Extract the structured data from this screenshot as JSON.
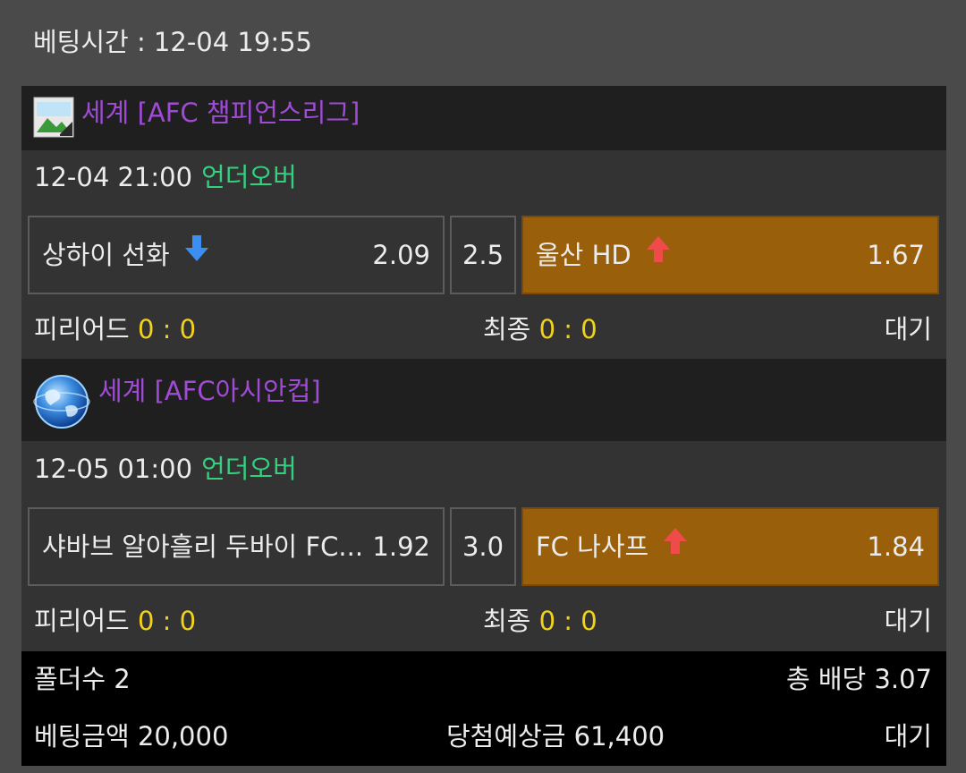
{
  "bet_time": "베팅시간 : 12-04 19:55",
  "matches": [
    {
      "league": "세계 [AFC 챔피언스리그]",
      "league_icon": "broken-image-icon",
      "time": "12-04 21:00",
      "type": "언더오버",
      "home": {
        "name": "상하이 선화",
        "odds": "2.09",
        "arrow": "down"
      },
      "line": "2.5",
      "away": {
        "name": "울산 HD",
        "odds": "1.67",
        "arrow": "up",
        "selected": true
      },
      "period_label": "피리어드",
      "period_score": "0 : 0",
      "final_label": "최종",
      "final_score": "0 : 0",
      "status": "대기"
    },
    {
      "league": "세계 [AFC아시안컵]",
      "league_icon": "globe-icon",
      "time": "12-05 01:00",
      "type": "언더오버",
      "home": {
        "name": "샤바브 알아흘리 두바이 FC...",
        "odds": "1.92"
      },
      "line": "3.0",
      "away": {
        "name": "FC 나사프",
        "odds": "1.84",
        "arrow": "up",
        "selected": true
      },
      "period_label": "피리어드",
      "period_score": "0 : 0",
      "final_label": "최종",
      "final_score": "0 : 0",
      "status": "대기"
    }
  ],
  "summary": {
    "folders": "폴더수 2",
    "total_odds": "총 배당 3.07",
    "bet_amount": "베팅금액 20,000",
    "expected_win": "당첨예상금 61,400",
    "status": "대기"
  },
  "colors": {
    "selected_bg": "#9a5f0a",
    "league_text": "#a04bd6",
    "type_text": "#35d07f",
    "score_text": "#f2d21a",
    "arrow_down": "#3b8ff0",
    "arrow_up": "#f04b4b"
  }
}
